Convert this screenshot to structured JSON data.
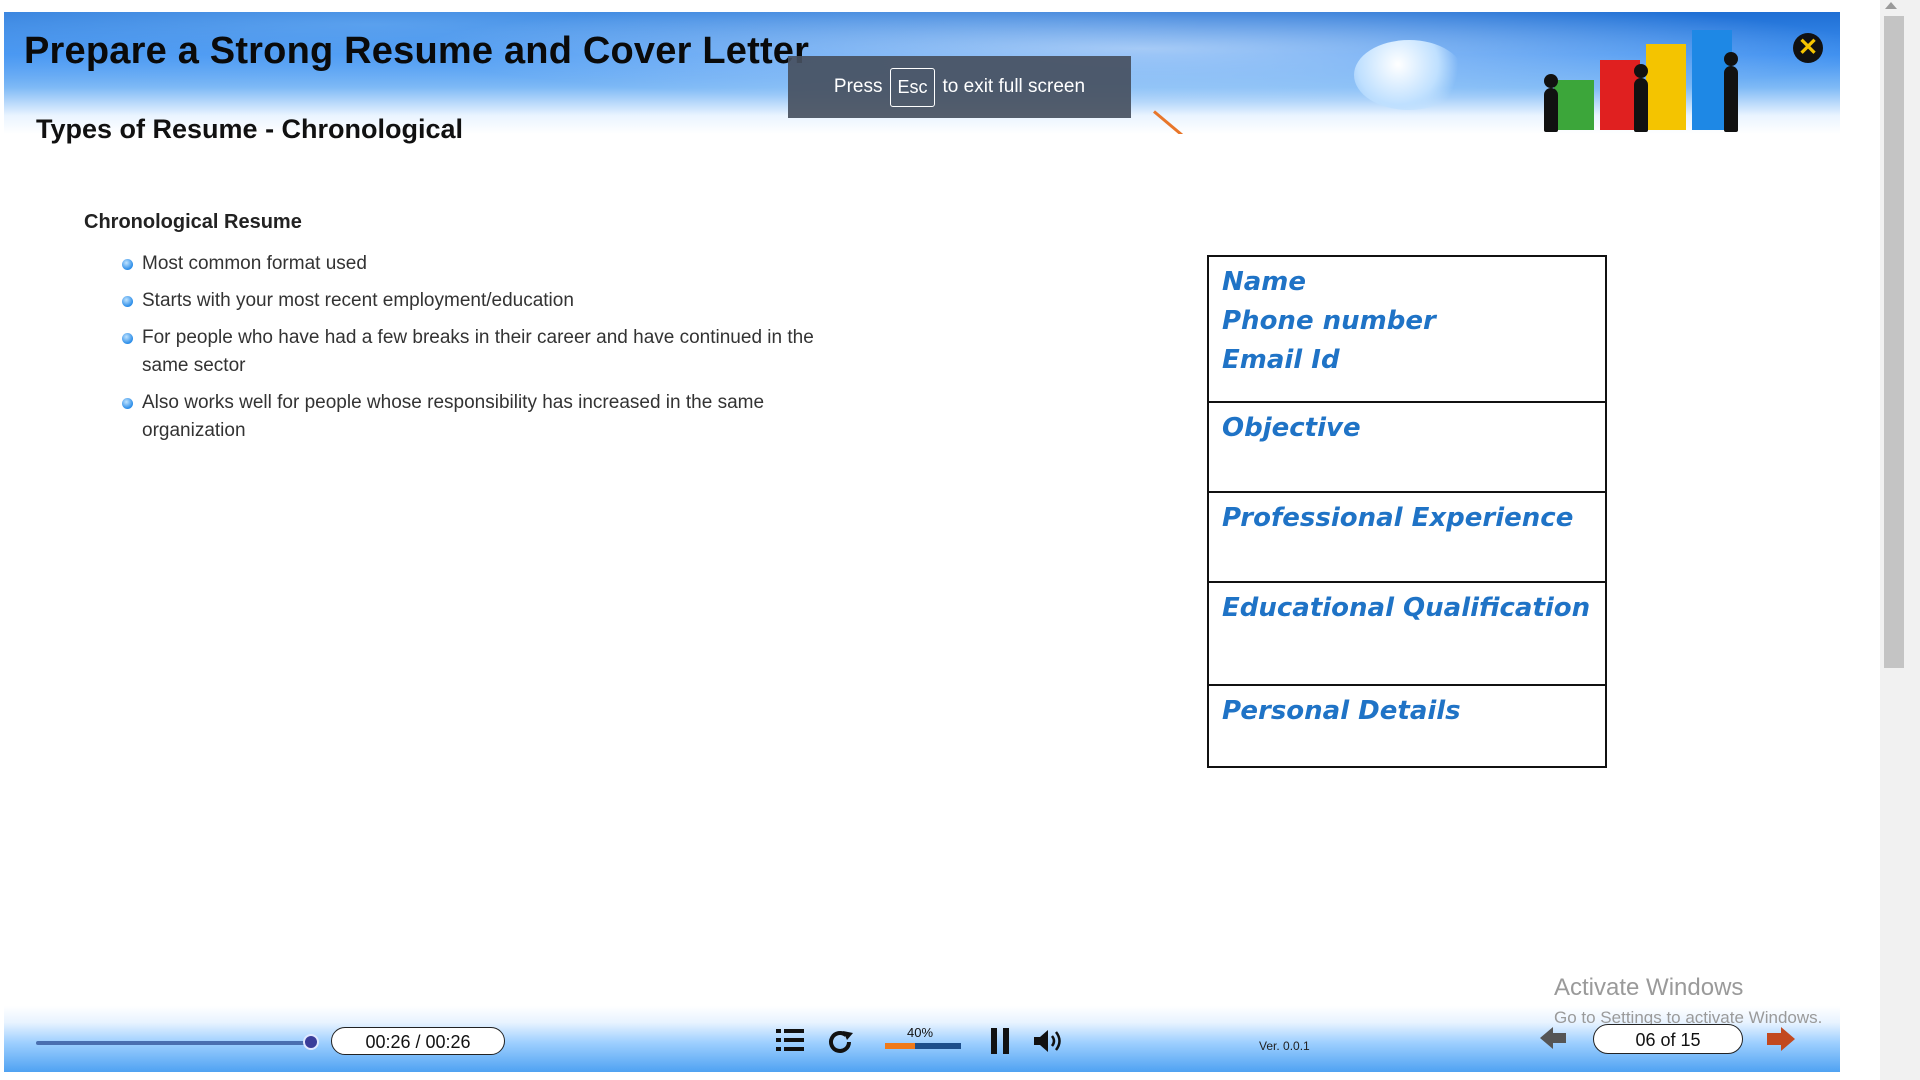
{
  "header": {
    "course_title": "Prepare a Strong Resume and Cover Letter",
    "page_title": "Types of Resume - Chronological",
    "close_icon": "close-icon",
    "accent_orange": "#e8762a"
  },
  "fullscreen_notice": {
    "press": "Press",
    "key": "Esc",
    "suffix": "to exit full screen"
  },
  "content": {
    "heading": "Chronological Resume",
    "bullets": [
      "Most common format used",
      "Starts with your most recent employment/education",
      "For people who have had a few breaks in their career and have continued in the same sector",
      "Also works well for people whose responsibility has increased in the same organization"
    ]
  },
  "resume_diagram": {
    "text_color": "#1f73c6",
    "sections": [
      {
        "lines": [
          "Name",
          "Phone number",
          "Email Id"
        ]
      },
      {
        "lines": [
          "Objective"
        ]
      },
      {
        "lines": [
          "Professional Experience"
        ]
      },
      {
        "lines": [
          "Educational Qualification"
        ]
      },
      {
        "lines": [
          "Personal Details"
        ]
      }
    ]
  },
  "watermark": {
    "line1": "Activate Windows",
    "line2": "Go to Settings to activate Windows."
  },
  "player": {
    "time": "00:26 / 00:26",
    "progress_fraction": 1.0,
    "volume_label": "40%",
    "volume_fraction": 0.4,
    "version": "Ver. 0.0.1",
    "page_indicator": "06 of 15",
    "icons": {
      "menu": "list-menu-icon",
      "replay": "replay-icon",
      "pause": "pause-icon",
      "volume": "speaker-icon",
      "prev": "arrow-left-icon",
      "next": "arrow-right-icon"
    }
  }
}
